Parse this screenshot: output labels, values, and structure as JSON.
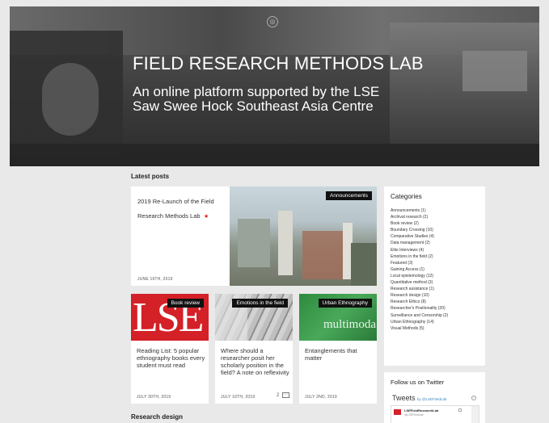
{
  "hero": {
    "title": "FIELD RESEARCH METHODS LAB",
    "subtitle": "An online platform supported by the LSE Saw Swee Hock Southeast Asia Centre"
  },
  "latest": {
    "heading": "Latest posts",
    "featured": {
      "title": "2019 Re-Launch of the Field Research Methods Lab",
      "star": "★",
      "date": "JUNE 19TH, 2019",
      "tag": "Announcements"
    },
    "posts": [
      {
        "tag": "Book review",
        "title": "Reading List: 5 popular ethnography books every student must read",
        "date": "JULY 30TH, 2019",
        "image_text": "LSE"
      },
      {
        "tag": "Emotions in the field",
        "title": "Where should a researcher posit her scholarly position in the field? A note on reflexivity",
        "date": "JULY 16TH, 2019",
        "comments": "2"
      },
      {
        "tag": "Urban Ethnography",
        "title": "Entanglements that matter",
        "date": "JULY 2ND, 2019",
        "image_text": "multimoda"
      }
    ]
  },
  "research_design": {
    "heading": "Research design"
  },
  "sidebar": {
    "categories_heading": "Categories",
    "categories": [
      "Announcements (1)",
      "Archival research (2)",
      "Book review (2)",
      "Boundary Crossing (10)",
      "Comparative Studies (4)",
      "Data management (2)",
      "Elite Interviews (4)",
      "Emotions in the field (2)",
      "Featured (3)",
      "Gaining Access (1)",
      "Local epistemology (12)",
      "Quantitative method (3)",
      "Research assistance (1)",
      "Research design (10)",
      "Research Ethics (8)",
      "Researcher's Positionality (20)",
      "Surveillance and Censorship (2)",
      "Urban Ethnography (14)",
      "Visual Methods (5)"
    ],
    "twitter": {
      "heading": "Follow us on Twitter",
      "tweets_label": "Tweets",
      "by": "by @LSEFieldLab",
      "account": "LSEFieldResearchLab",
      "handle": "@LSEFieldLab"
    }
  },
  "colors": {
    "background": "#e9e9e9",
    "lse_red": "#d42027",
    "tag_bg": "#111111"
  }
}
